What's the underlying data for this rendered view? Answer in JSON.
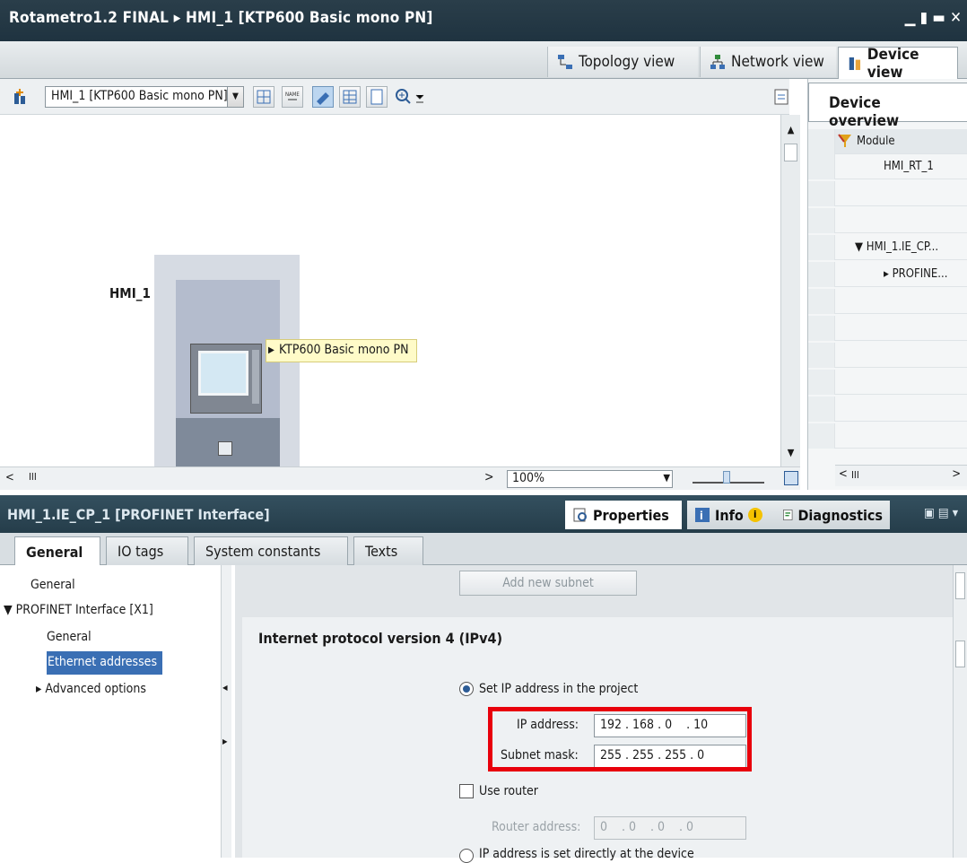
{
  "title": "Rotametro1.2 FINAL ▸ HMI_1 [KTP600 Basic mono PN]",
  "view_tabs": {
    "topology": "Topology view",
    "network": "Network view",
    "device": "Device view"
  },
  "toolbar": {
    "device_select": "HMI_1 [KTP600 Basic mono PN]"
  },
  "canvas": {
    "device_label": "HMI_1",
    "tooltip": "KTP600 Basic mono PN",
    "zoom": "100%",
    "hscroll_marker": "III"
  },
  "device_overview": {
    "title": "Device overview",
    "column_module": "Module",
    "rows": [
      "HMI_RT_1",
      "",
      "",
      "▼ HMI_1.IE_CP...",
      "▸ PROFINE...",
      "",
      "",
      "",
      "",
      "",
      ""
    ],
    "hscroll_marker": "III"
  },
  "properties": {
    "title": "HMI_1.IE_CP_1 [PROFINET Interface]",
    "tabs": {
      "properties": "Properties",
      "info": "Info",
      "diagnostics": "Diagnostics"
    },
    "subtabs": [
      "General",
      "IO tags",
      "System constants",
      "Texts"
    ]
  },
  "nav": {
    "items": [
      {
        "label": "General",
        "indent": 0,
        "selected": false
      },
      {
        "label": "▼ PROFINET Interface [X1]",
        "indent": 0,
        "selected": false
      },
      {
        "label": "General",
        "indent": 1,
        "selected": false
      },
      {
        "label": "Ethernet addresses",
        "indent": 1,
        "selected": true
      },
      {
        "label": "▸ Advanced options",
        "indent": 1,
        "selected": false
      }
    ]
  },
  "ipv4": {
    "add_subnet_button": "Add new subnet",
    "section_title": "Internet protocol version 4 (IPv4)",
    "set_ip_in_project": "Set IP address in the project",
    "ip_label": "IP address:",
    "ip_value": "192 . 168 . 0    . 10",
    "mask_label": "Subnet mask:",
    "mask_value": "255 . 255 . 255 . 0",
    "use_router": "Use router",
    "router_label": "Router address:",
    "router_value": "0    . 0    . 0    . 0",
    "ip_set_at_device": "IP address is set directly at the device"
  },
  "colors": {
    "highlight_box": "#e8000b",
    "selection": "#3a6fb4"
  }
}
